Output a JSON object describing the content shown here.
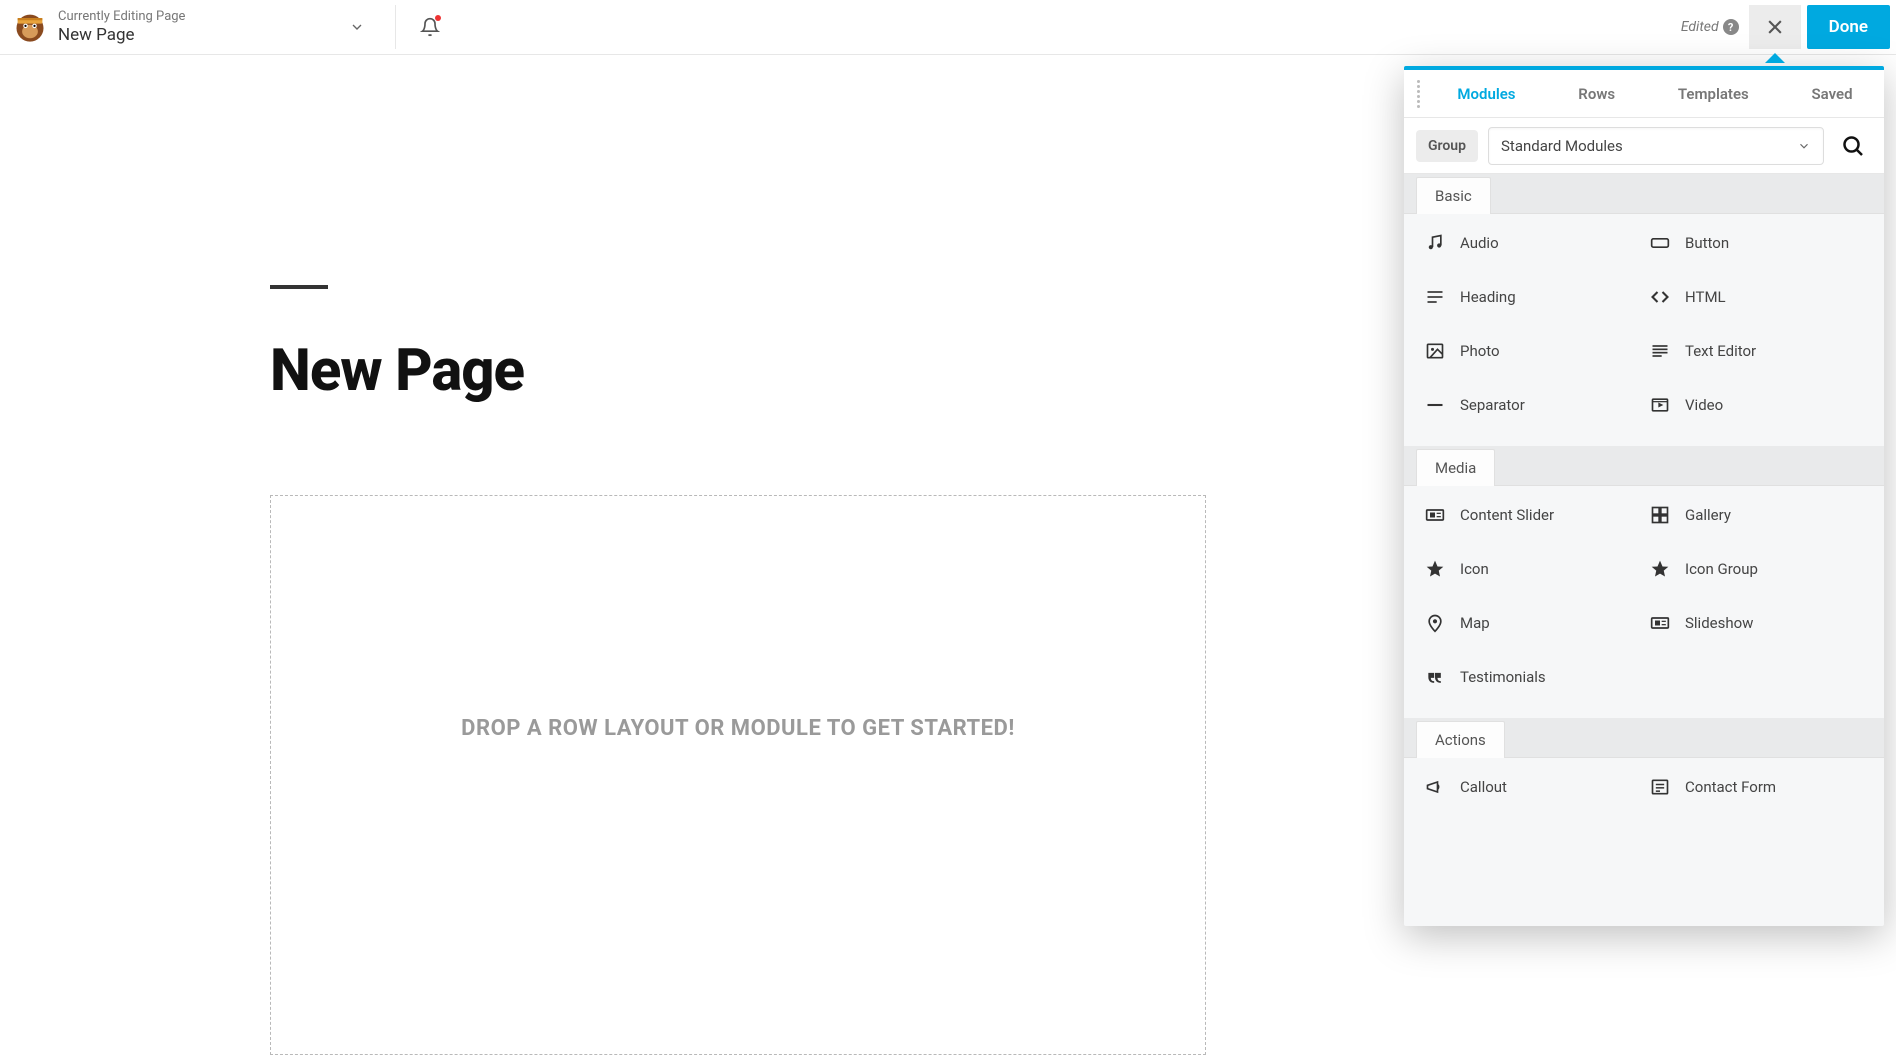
{
  "topbar": {
    "subtitle": "Currently Editing Page",
    "title": "New Page",
    "edited_label": "Edited",
    "done_label": "Done"
  },
  "canvas": {
    "page_title": "New Page",
    "dropzone_text": "DROP A ROW LAYOUT OR MODULE TO GET STARTED!"
  },
  "panel": {
    "tabs": [
      "Modules",
      "Rows",
      "Templates",
      "Saved"
    ],
    "active_tab": 0,
    "group_label": "Group",
    "select_value": "Standard Modules",
    "sections": [
      {
        "title": "Basic",
        "items": [
          {
            "icon": "music",
            "label": "Audio"
          },
          {
            "icon": "button",
            "label": "Button"
          },
          {
            "icon": "heading",
            "label": "Heading"
          },
          {
            "icon": "code",
            "label": "HTML"
          },
          {
            "icon": "image",
            "label": "Photo"
          },
          {
            "icon": "text",
            "label": "Text Editor"
          },
          {
            "icon": "separator",
            "label": "Separator"
          },
          {
            "icon": "video",
            "label": "Video"
          }
        ]
      },
      {
        "title": "Media",
        "items": [
          {
            "icon": "slider",
            "label": "Content Slider"
          },
          {
            "icon": "gallery",
            "label": "Gallery"
          },
          {
            "icon": "star",
            "label": "Icon"
          },
          {
            "icon": "star",
            "label": "Icon Group"
          },
          {
            "icon": "pin",
            "label": "Map"
          },
          {
            "icon": "slider",
            "label": "Slideshow"
          },
          {
            "icon": "quote",
            "label": "Testimonials"
          }
        ]
      },
      {
        "title": "Actions",
        "items": [
          {
            "icon": "megaphone",
            "label": "Callout"
          },
          {
            "icon": "form",
            "label": "Contact Form"
          }
        ]
      }
    ]
  }
}
